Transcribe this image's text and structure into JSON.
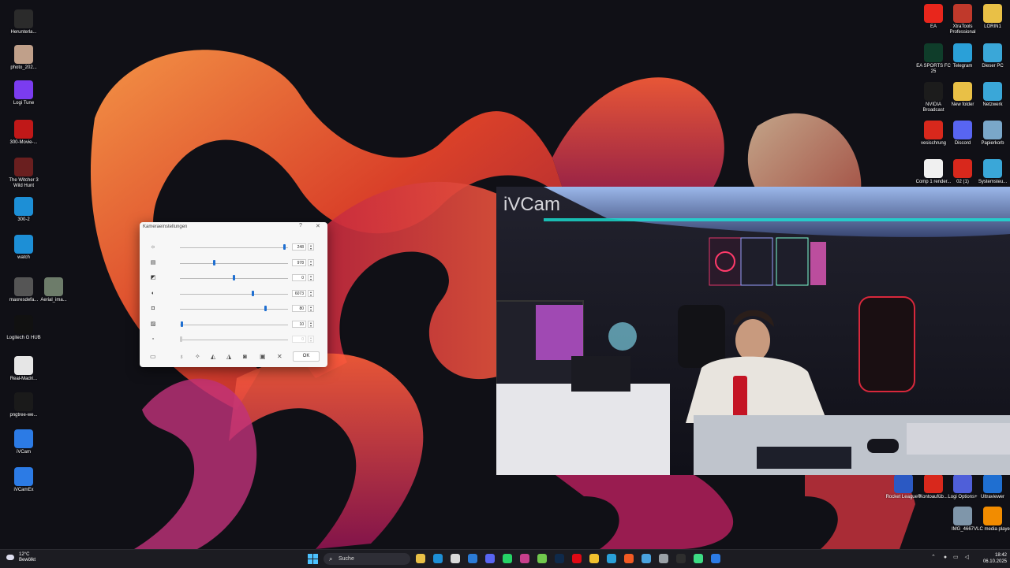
{
  "desktop": {
    "left_icons": [
      {
        "label": "Herunterla...",
        "icon": "folder-icon",
        "color": "#2b2b2b"
      },
      {
        "label": "photo_202...",
        "icon": "image-file-icon",
        "color": "#c0a08a"
      },
      {
        "label": "Logi Tune",
        "icon": "logi-tune-icon",
        "color": "#7b3cf0"
      },
      {
        "label": "300-Movie-...",
        "icon": "movie-file-icon",
        "color": "#c01818"
      },
      {
        "label": "The Witcher 3 Wild Hunt",
        "icon": "witcher-game-icon",
        "color": "#6a1f1f"
      },
      {
        "label": "300-2",
        "icon": "edge-browser-icon",
        "color": "#1d8fd6"
      },
      {
        "label": "watch",
        "icon": "edge-browser-icon",
        "color": "#1d8fd6"
      },
      {
        "label": "maxresdefa...",
        "icon": "image-file-icon",
        "color": "#555555"
      },
      {
        "label": "Aerial_ima...",
        "icon": "image-file-icon",
        "color": "#6d7c6a"
      },
      {
        "label": "Logitech G HUB",
        "icon": "logitech-g-icon",
        "color": "#111111"
      },
      {
        "label": "Real-Madri...",
        "icon": "image-file-icon",
        "color": "#e6e6e6"
      },
      {
        "label": "pngtree-we...",
        "icon": "image-file-icon",
        "color": "#1a1a1a"
      },
      {
        "label": "iVCam",
        "icon": "ivcam-icon",
        "color": "#2c7be5"
      },
      {
        "label": "iVCamEx",
        "icon": "ivcam-icon",
        "color": "#2c7be5"
      }
    ],
    "right_icons": [
      {
        "label": "EA",
        "icon": "ea-app-icon",
        "color": "#e8261c"
      },
      {
        "label": "XtraTools Professional",
        "icon": "xtratools-icon",
        "color": "#c0392b"
      },
      {
        "label": "LORIN1",
        "icon": "folder-icon",
        "color": "#e9c046"
      },
      {
        "label": "EA SPORTS FC 25",
        "icon": "fc25-game-icon",
        "color": "#0f3d2a"
      },
      {
        "label": "Telegram",
        "icon": "telegram-icon",
        "color": "#2aa0d8"
      },
      {
        "label": "Dieser PC",
        "icon": "computer-icon",
        "color": "#3aa7d8"
      },
      {
        "label": "NVIDIA Broadcast",
        "icon": "nvidia-icon",
        "color": "#1c1c1c"
      },
      {
        "label": "New folder",
        "icon": "folder-icon",
        "color": "#e9c046"
      },
      {
        "label": "Netzwerk",
        "icon": "network-icon",
        "color": "#3aa7d8"
      },
      {
        "label": "vesischrung",
        "icon": "pdf-file-icon",
        "color": "#d8281c"
      },
      {
        "label": "Discord",
        "icon": "discord-icon",
        "color": "#5865f2"
      },
      {
        "label": "Papierkorb",
        "icon": "recycle-bin-icon",
        "color": "#7aa7c9"
      },
      {
        "label": "Comp 1 render...",
        "icon": "file-icon",
        "color": "#f0f0f0"
      },
      {
        "label": "02 (1)",
        "icon": "pdf-file-icon",
        "color": "#d8281c"
      },
      {
        "label": "Systemsteu...",
        "icon": "control-panel-icon",
        "color": "#3aa7d8"
      }
    ],
    "bottom_right_icons": [
      {
        "label": "Rocket League®",
        "icon": "rocket-league-icon",
        "color": "#2b59c3"
      },
      {
        "label": "Kontoaufüb...",
        "icon": "pdf-file-icon",
        "color": "#d8281c"
      },
      {
        "label": "Logi Options+",
        "icon": "logi-options-icon",
        "color": "#4f5fd9"
      },
      {
        "label": "Ultraviewer",
        "icon": "ultraviewer-icon",
        "color": "#1f6fd1"
      },
      {
        "label": "IMG_4667",
        "icon": "image-file-icon",
        "color": "#7f96aa"
      },
      {
        "label": "VLC media player",
        "icon": "vlc-icon",
        "color": "#f28c00"
      }
    ]
  },
  "camera_window": {
    "brand": "iVCam"
  },
  "settings_dialog": {
    "title": "Kameraeinstellungen",
    "help_label": "?",
    "close_label": "✕",
    "rows": [
      {
        "icon": "brightness-icon",
        "value": "248",
        "level": 0.98,
        "enabled": true
      },
      {
        "icon": "contrast-icon",
        "value": "978",
        "level": 0.31,
        "enabled": true
      },
      {
        "icon": "saturation-icon",
        "value": "0",
        "level": 0.5,
        "enabled": true
      },
      {
        "icon": "hue-icon",
        "value": "6073",
        "level": 0.68,
        "enabled": true
      },
      {
        "icon": "sharpness-icon",
        "value": "80",
        "level": 0.8,
        "enabled": true
      },
      {
        "icon": "zoom-icon",
        "value": "10",
        "level": 0.01,
        "enabled": true
      },
      {
        "icon": "focus-icon",
        "value": "0",
        "level": 0.0,
        "enabled": false
      }
    ],
    "ok_label": "OK"
  },
  "taskbar": {
    "weather_temp": "12°C",
    "weather_desc": "Bewölkt",
    "search_placeholder": "Suche",
    "apps": [
      {
        "icon": "file-explorer-icon",
        "color": "#e9c046"
      },
      {
        "icon": "edge-browser-icon",
        "color": "#1d8fd6"
      },
      {
        "icon": "mail-icon",
        "color": "#d9d9d9"
      },
      {
        "icon": "vscode-icon",
        "color": "#2b7bd6"
      },
      {
        "icon": "discord-icon",
        "color": "#5865f2"
      },
      {
        "icon": "whatsapp-icon",
        "color": "#25d366"
      },
      {
        "icon": "photos-icon",
        "color": "#c83f8c"
      },
      {
        "icon": "xbox-icon",
        "color": "#71c94d"
      },
      {
        "icon": "photoshop-icon",
        "color": "#0f2a4b"
      },
      {
        "icon": "netflix-icon",
        "color": "#e00914"
      },
      {
        "icon": "chrome-icon",
        "color": "#f2c12e"
      },
      {
        "icon": "telegram-icon",
        "color": "#2aa0d8"
      },
      {
        "icon": "brave-icon",
        "color": "#f25a23"
      },
      {
        "icon": "browser-icon",
        "color": "#4aa3df"
      },
      {
        "icon": "settings-icon",
        "color": "#9aa0a6"
      },
      {
        "icon": "terminal-icon",
        "color": "#2e2e2e"
      },
      {
        "icon": "android-icon",
        "color": "#3ddc84"
      },
      {
        "icon": "ivcam-icon",
        "color": "#2c7be5"
      }
    ],
    "time": "18:42",
    "date": "06.10.2025"
  }
}
